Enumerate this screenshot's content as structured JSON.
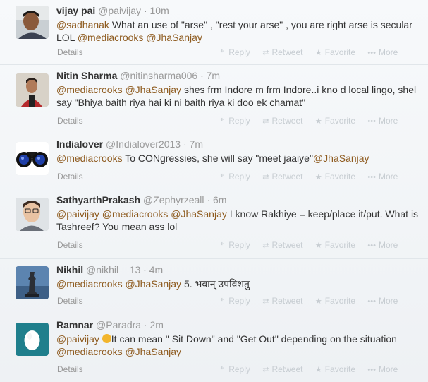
{
  "tweets": [
    {
      "fullname": "vijay pai",
      "username": "@paivijay",
      "time": "10m",
      "text_parts": [
        {
          "t": "@sadhanak",
          "m": true
        },
        {
          "t": " What an use of \"arse\" , \"rest your arse\" , you are right arse is secular LOL ",
          "m": false
        },
        {
          "t": "@mediacrooks",
          "m": true
        },
        {
          "t": " ",
          "m": false
        },
        {
          "t": "@JhaSanjay",
          "m": true
        }
      ]
    },
    {
      "fullname": "Nitin Sharma",
      "username": "@nitinsharma006",
      "time": "7m",
      "text_parts": [
        {
          "t": "@mediacrooks",
          "m": true
        },
        {
          "t": " ",
          "m": false
        },
        {
          "t": "@JhaSanjay",
          "m": true
        },
        {
          "t": " shes frm Indore m frm Indore..i kno d local lingo, shel say \"Bhiya baith riya hai ki ni baith riya ki doo ek chamat\"",
          "m": false
        }
      ]
    },
    {
      "fullname": "Indialover",
      "username": "@Indialover2013",
      "time": "7m",
      "text_parts": [
        {
          "t": "@mediacrooks",
          "m": true
        },
        {
          "t": " To CONgressies, she will say \"meet jaaiye\"",
          "m": false
        },
        {
          "t": "@JhaSanjay",
          "m": true
        }
      ]
    },
    {
      "fullname": "SathyarthPrakash",
      "username": "@Zephyrzeall",
      "time": "6m",
      "text_parts": [
        {
          "t": "@paivijay",
          "m": true
        },
        {
          "t": " ",
          "m": false
        },
        {
          "t": "@mediacrooks",
          "m": true
        },
        {
          "t": " ",
          "m": false
        },
        {
          "t": "@JhaSanjay",
          "m": true
        },
        {
          "t": " I know Rakhiye = keep/place it/put. What is Tashreef? You mean ass lol",
          "m": false
        }
      ]
    },
    {
      "fullname": "Nikhil",
      "username": "@nikhil__13",
      "time": "4m",
      "text_parts": [
        {
          "t": "@mediacrooks",
          "m": true
        },
        {
          "t": " ",
          "m": false
        },
        {
          "t": "@JhaSanjay",
          "m": true
        },
        {
          "t": " 5. भवान् उपविशतु",
          "m": false
        }
      ]
    },
    {
      "fullname": "Ramnar",
      "username": "@Paradra",
      "time": "2m",
      "text_parts": [
        {
          "t": "@paivijay",
          "m": true
        },
        {
          "t": " ",
          "m": false
        },
        {
          "t": "It can mean \" Sit Down\" and \"Get Out\" depending on the situation ",
          "m": false
        },
        {
          "t": "@mediacrooks",
          "m": true
        },
        {
          "t": " ",
          "m": false
        },
        {
          "t": "@JhaSanjay",
          "m": true
        }
      ],
      "has_emoji": true
    }
  ],
  "labels": {
    "details": "Details",
    "reply": "Reply",
    "retweet": "Retweet",
    "favorite": "Favorite",
    "more": "More",
    "separator": "·"
  },
  "icons": {
    "reply": "reply-icon",
    "retweet": "retweet-icon",
    "favorite": "star-icon",
    "more": "more-dots-icon"
  },
  "colors": {
    "mention": "#8e5b1f",
    "name": "#333333",
    "meta": "#999999",
    "action": "#c7cdd2"
  }
}
